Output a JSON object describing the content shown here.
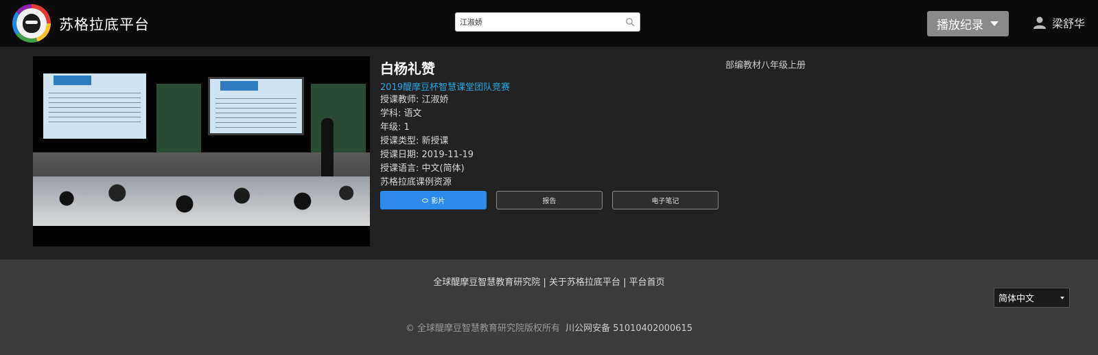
{
  "header": {
    "brand": "苏格拉底平台",
    "search_value": "江淑娇",
    "history_label": "播放纪录",
    "user_name": "梁舒华"
  },
  "lesson": {
    "title": "白杨礼赞",
    "competition": "2019醍摩豆杯智慧课堂团队竞赛",
    "teacher": "授课教师: 江淑娇",
    "subject": "学科: 语文",
    "grade": "年级: 1",
    "type": "授课类型: 新授课",
    "date": "授课日期: 2019-11-19",
    "language": "授课语言: 中文(简体)",
    "source": "苏格拉底课例资源",
    "textbook": "部编教材八年级上册"
  },
  "buttons": {
    "video": "影片",
    "report": "报告",
    "notes": "电子笔记"
  },
  "footer": {
    "links": "全球醍摩豆智慧教育研究院 | 关于苏格拉底平台 | 平台首页",
    "language": "简体中文",
    "copyright": "© 全球醍摩豆智慧教育研究院版权所有",
    "icp": "川公网安备 51010402000615"
  }
}
